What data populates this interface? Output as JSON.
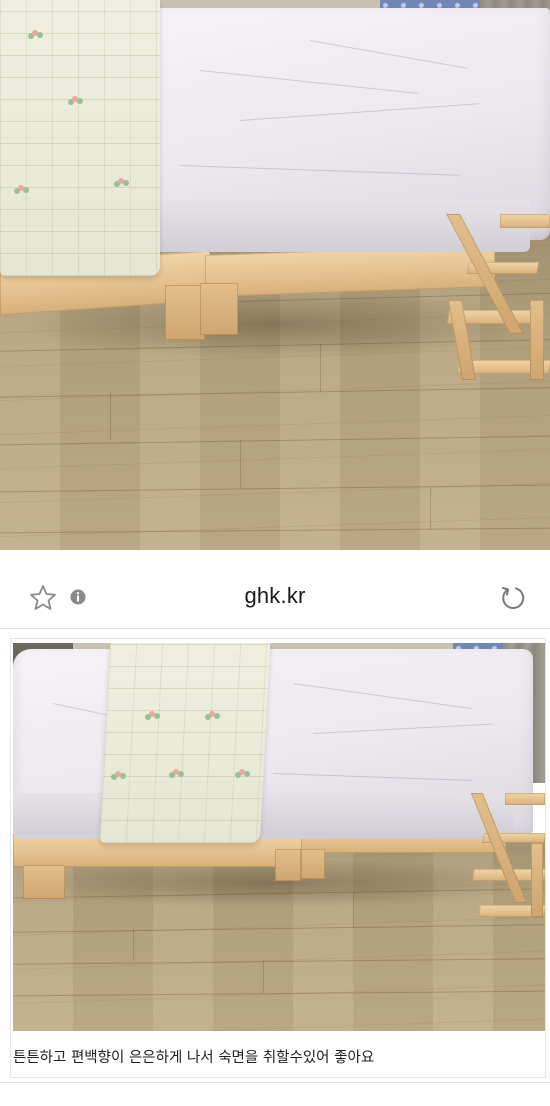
{
  "browser": {
    "url": "ghk.kr",
    "icons": {
      "bookmark": "star-icon",
      "info": "info-icon",
      "reload": "reload-icon"
    }
  },
  "review": {
    "caption": "튼튼하고 편백향이 은은하게 나서 숙면을 취할수있어 좋아요"
  },
  "colors": {
    "wood": "#e3c08e",
    "mattress": "#ebe8ee",
    "floor": "#b9a682",
    "icon_gray": "#7a7a7a"
  }
}
